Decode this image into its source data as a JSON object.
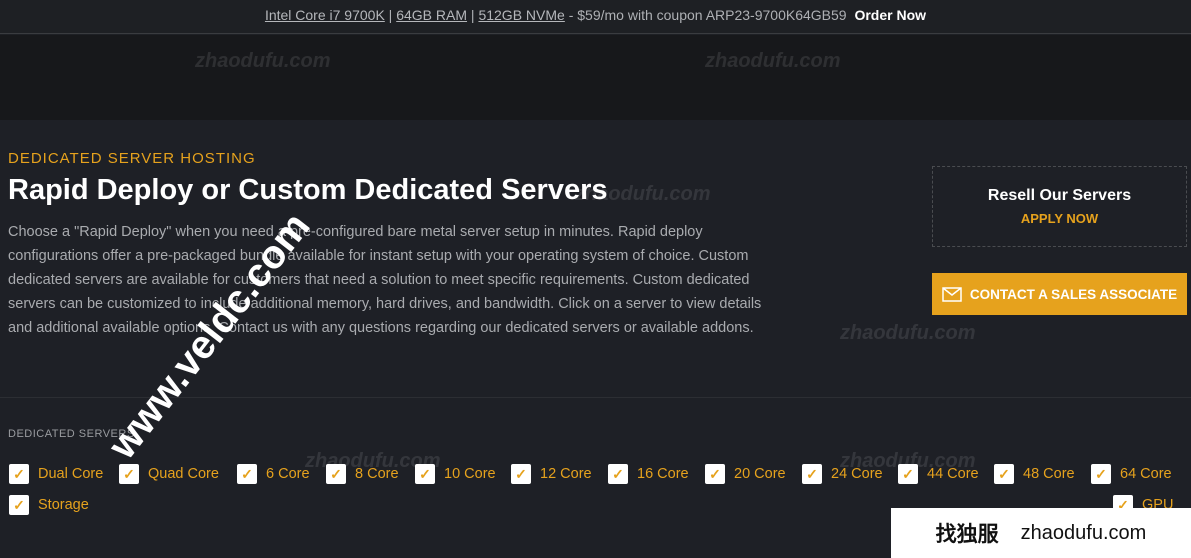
{
  "promo": {
    "link_parts": [
      "Intel Core i7 9700K",
      "64GB RAM",
      "512GB NVMe"
    ],
    "separator": " | ",
    "text": " - $59/mo with coupon ARP23-9700K64GB59",
    "order": "Order Now"
  },
  "hero": {
    "eyebrow": "DEDICATED SERVER HOSTING",
    "title": "Rapid Deploy or Custom Dedicated Servers",
    "description": "Choose a \"Rapid Deploy\" when you need a pre-configured bare metal server setup in minutes. Rapid deploy configurations offer a pre-packaged bundle available for instant setup with your operating system of choice. Custom dedicated servers are available for customers that need a solution to meet specific requirements. Custom dedicated servers can be customized to include additional memory, hard drives, and bandwidth. Click on a server to view details and additional available options. Contact us with any questions regarding our dedicated servers or available addons."
  },
  "resell": {
    "title": "Resell Our Servers",
    "apply": "APPLY NOW"
  },
  "contact": {
    "label": "CONTACT A SALES ASSOCIATE",
    "icon": "envelope-icon"
  },
  "filters": {
    "heading": "DEDICATED SERVERS",
    "items": [
      "Dual Core",
      "Quad Core",
      "6 Core",
      "8 Core",
      "10 Core",
      "12 Core",
      "16 Core",
      "20 Core",
      "24 Core",
      "44 Core",
      "48 Core",
      "64 Core",
      "Storage",
      "GPU"
    ],
    "checked": true
  },
  "watermarks": {
    "site": "zhaodufu.com",
    "veldc": "www.veldc.com",
    "badge_cn": "找独服",
    "badge_en": "zhaodufu.com"
  },
  "colors": {
    "accent": "#e6a21d",
    "background": "#1e2026"
  }
}
